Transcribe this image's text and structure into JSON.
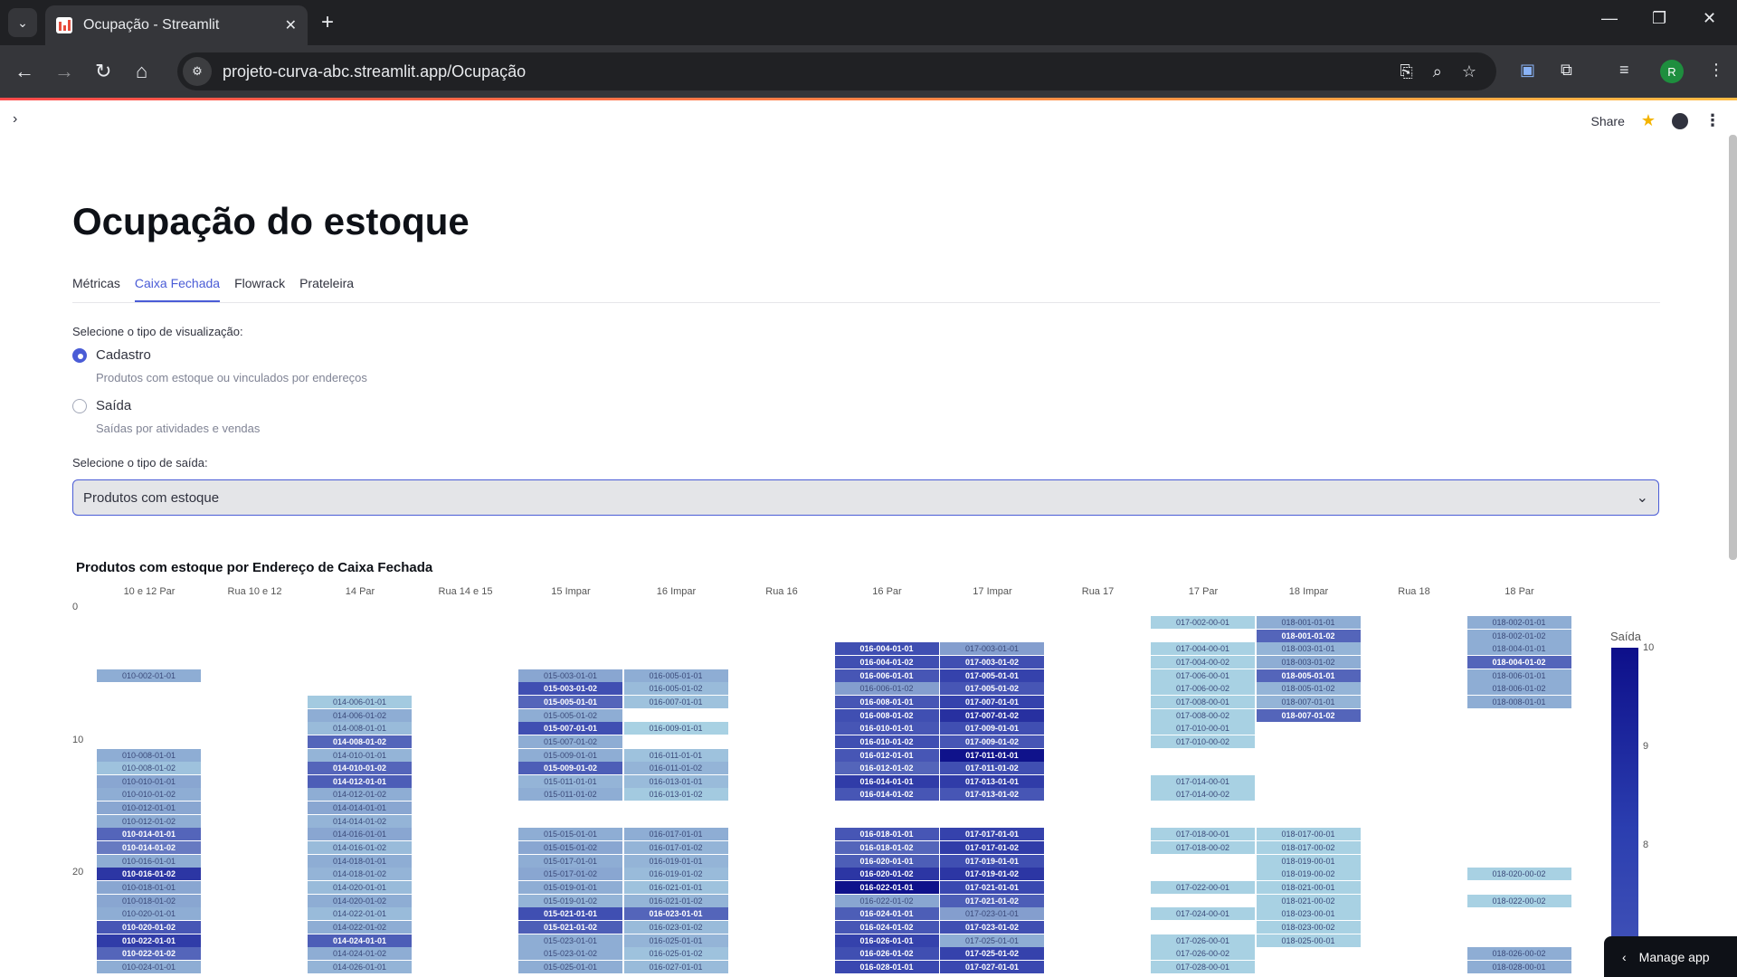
{
  "browser": {
    "tab_title": "Ocupação - Streamlit",
    "url": "projeto-curva-abc.streamlit.app/Ocupação",
    "profile_initial": "R"
  },
  "header": {
    "share_label": "Share"
  },
  "page": {
    "title": "Ocupação do estoque",
    "tabs": [
      "Métricas",
      "Caixa Fechada",
      "Flowrack",
      "Prateleira"
    ],
    "active_tab": "Caixa Fechada",
    "viz_label": "Selecione o tipo de visualização:",
    "viz_options": [
      {
        "label": "Cadastro",
        "caption": "Produtos com estoque ou vinculados por endereços",
        "selected": true
      },
      {
        "label": "Saída",
        "caption": "Saídas por atividades e vendas",
        "selected": false
      }
    ],
    "saida_label": "Selecione o tipo de saída:",
    "saida_value": "Produtos com estoque"
  },
  "chart_data": {
    "type": "heatmap",
    "title": "Produtos com estoque por Endereço de Caixa Fechada",
    "columns": [
      "10 e 12 Par",
      "Rua 10 e 12",
      "14 Par",
      "Rua 14 e 15",
      "15 Impar",
      "16 Impar",
      "Rua 16",
      "16 Par",
      "17 Impar",
      "Rua 17",
      "17 Par",
      "18 Impar",
      "Rua 18",
      "18 Par"
    ],
    "y_ticks": [
      0,
      10,
      20
    ],
    "legend_title": "Saída",
    "legend_ticks": [
      10,
      9,
      8
    ],
    "cells": [
      {
        "col": 0,
        "row": 4,
        "label": "010-002-01-01",
        "v": 7.6
      },
      {
        "col": 0,
        "row": 10,
        "label": "010-008-01-01",
        "v": 7.6
      },
      {
        "col": 0,
        "row": 11,
        "label": "010-008-01-02",
        "v": 7.3
      },
      {
        "col": 0,
        "row": 12,
        "label": "010-010-01-01",
        "v": 7.7
      },
      {
        "col": 0,
        "row": 13,
        "label": "010-010-01-02",
        "v": 7.6
      },
      {
        "col": 0,
        "row": 14,
        "label": "010-012-01-01",
        "v": 7.7
      },
      {
        "col": 0,
        "row": 15,
        "label": "010-012-01-02",
        "v": 7.6
      },
      {
        "col": 0,
        "row": 16,
        "label": "010-014-01-01",
        "v": 8.6
      },
      {
        "col": 0,
        "row": 17,
        "label": "010-014-01-02",
        "v": 8.3
      },
      {
        "col": 0,
        "row": 18,
        "label": "010-016-01-01",
        "v": 7.6
      },
      {
        "col": 0,
        "row": 19,
        "label": "010-016-01-02",
        "v": 9.3
      },
      {
        "col": 0,
        "row": 20,
        "label": "010-018-01-01",
        "v": 7.7
      },
      {
        "col": 0,
        "row": 21,
        "label": "010-018-01-02",
        "v": 7.7
      },
      {
        "col": 0,
        "row": 22,
        "label": "010-020-01-01",
        "v": 7.6
      },
      {
        "col": 0,
        "row": 23,
        "label": "010-020-01-02",
        "v": 8.8
      },
      {
        "col": 0,
        "row": 24,
        "label": "010-022-01-01",
        "v": 9.2
      },
      {
        "col": 0,
        "row": 25,
        "label": "010-022-01-02",
        "v": 8.6
      },
      {
        "col": 0,
        "row": 26,
        "label": "010-024-01-01",
        "v": 7.6
      },
      {
        "col": 2,
        "row": 6,
        "label": "014-006-01-01",
        "v": 7.2
      },
      {
        "col": 2,
        "row": 7,
        "label": "014-006-01-02",
        "v": 7.6
      },
      {
        "col": 2,
        "row": 8,
        "label": "014-008-01-01",
        "v": 7.4
      },
      {
        "col": 2,
        "row": 9,
        "label": "014-008-01-02",
        "v": 8.6
      },
      {
        "col": 2,
        "row": 10,
        "label": "014-010-01-01",
        "v": 7.5
      },
      {
        "col": 2,
        "row": 11,
        "label": "014-010-01-02",
        "v": 8.6
      },
      {
        "col": 2,
        "row": 12,
        "label": "014-012-01-01",
        "v": 8.7
      },
      {
        "col": 2,
        "row": 13,
        "label": "014-012-01-02",
        "v": 7.6
      },
      {
        "col": 2,
        "row": 14,
        "label": "014-014-01-01",
        "v": 7.7
      },
      {
        "col": 2,
        "row": 15,
        "label": "014-014-01-02",
        "v": 7.5
      },
      {
        "col": 2,
        "row": 16,
        "label": "014-016-01-01",
        "v": 7.7
      },
      {
        "col": 2,
        "row": 17,
        "label": "014-016-01-02",
        "v": 7.4
      },
      {
        "col": 2,
        "row": 18,
        "label": "014-018-01-01",
        "v": 7.6
      },
      {
        "col": 2,
        "row": 19,
        "label": "014-018-01-02",
        "v": 7.5
      },
      {
        "col": 2,
        "row": 20,
        "label": "014-020-01-01",
        "v": 7.4
      },
      {
        "col": 2,
        "row": 21,
        "label": "014-020-01-02",
        "v": 7.6
      },
      {
        "col": 2,
        "row": 22,
        "label": "014-022-01-01",
        "v": 7.4
      },
      {
        "col": 2,
        "row": 23,
        "label": "014-022-01-02",
        "v": 7.6
      },
      {
        "col": 2,
        "row": 24,
        "label": "014-024-01-01",
        "v": 8.7
      },
      {
        "col": 2,
        "row": 25,
        "label": "014-024-01-02",
        "v": 7.6
      },
      {
        "col": 2,
        "row": 26,
        "label": "014-026-01-01",
        "v": 7.5
      },
      {
        "col": 4,
        "row": 4,
        "label": "015-003-01-01",
        "v": 7.7
      },
      {
        "col": 4,
        "row": 5,
        "label": "015-003-01-02",
        "v": 8.9
      },
      {
        "col": 4,
        "row": 6,
        "label": "015-005-01-01",
        "v": 8.6
      },
      {
        "col": 4,
        "row": 7,
        "label": "015-005-01-02",
        "v": 7.6
      },
      {
        "col": 4,
        "row": 8,
        "label": "015-007-01-01",
        "v": 8.9
      },
      {
        "col": 4,
        "row": 9,
        "label": "015-007-01-02",
        "v": 7.6
      },
      {
        "col": 4,
        "row": 10,
        "label": "015-009-01-01",
        "v": 7.6
      },
      {
        "col": 4,
        "row": 11,
        "label": "015-009-01-02",
        "v": 8.7
      },
      {
        "col": 4,
        "row": 12,
        "label": "015-011-01-01",
        "v": 7.5
      },
      {
        "col": 4,
        "row": 13,
        "label": "015-011-01-02",
        "v": 7.6
      },
      {
        "col": 4,
        "row": 16,
        "label": "015-015-01-01",
        "v": 7.6
      },
      {
        "col": 4,
        "row": 17,
        "label": "015-015-01-02",
        "v": 7.7
      },
      {
        "col": 4,
        "row": 18,
        "label": "015-017-01-01",
        "v": 7.6
      },
      {
        "col": 4,
        "row": 19,
        "label": "015-017-01-02",
        "v": 7.7
      },
      {
        "col": 4,
        "row": 20,
        "label": "015-019-01-01",
        "v": 7.6
      },
      {
        "col": 4,
        "row": 21,
        "label": "015-019-01-02",
        "v": 7.5
      },
      {
        "col": 4,
        "row": 22,
        "label": "015-021-01-01",
        "v": 8.9
      },
      {
        "col": 4,
        "row": 23,
        "label": "015-021-01-02",
        "v": 8.7
      },
      {
        "col": 4,
        "row": 24,
        "label": "015-023-01-01",
        "v": 7.6
      },
      {
        "col": 4,
        "row": 25,
        "label": "015-023-01-02",
        "v": 7.6
      },
      {
        "col": 4,
        "row": 26,
        "label": "015-025-01-01",
        "v": 7.6
      },
      {
        "col": 5,
        "row": 4,
        "label": "016-005-01-01",
        "v": 7.6
      },
      {
        "col": 5,
        "row": 5,
        "label": "016-005-01-02",
        "v": 7.4
      },
      {
        "col": 5,
        "row": 6,
        "label": "016-007-01-01",
        "v": 7.3
      },
      {
        "col": 5,
        "row": 8,
        "label": "016-009-01-01",
        "v": 7.1
      },
      {
        "col": 5,
        "row": 10,
        "label": "016-011-01-01",
        "v": 7.3
      },
      {
        "col": 5,
        "row": 11,
        "label": "016-011-01-02",
        "v": 7.5
      },
      {
        "col": 5,
        "row": 12,
        "label": "016-013-01-01",
        "v": 7.4
      },
      {
        "col": 5,
        "row": 13,
        "label": "016-013-01-02",
        "v": 7.2
      },
      {
        "col": 5,
        "row": 16,
        "label": "016-017-01-01",
        "v": 7.6
      },
      {
        "col": 5,
        "row": 17,
        "label": "016-017-01-02",
        "v": 7.5
      },
      {
        "col": 5,
        "row": 18,
        "label": "016-019-01-01",
        "v": 7.5
      },
      {
        "col": 5,
        "row": 19,
        "label": "016-019-01-02",
        "v": 7.4
      },
      {
        "col": 5,
        "row": 20,
        "label": "016-021-01-01",
        "v": 7.3
      },
      {
        "col": 5,
        "row": 21,
        "label": "016-021-01-02",
        "v": 7.5
      },
      {
        "col": 5,
        "row": 22,
        "label": "016-023-01-01",
        "v": 8.6
      },
      {
        "col": 5,
        "row": 23,
        "label": "016-023-01-02",
        "v": 7.4
      },
      {
        "col": 5,
        "row": 24,
        "label": "016-025-01-01",
        "v": 7.5
      },
      {
        "col": 5,
        "row": 25,
        "label": "016-025-01-02",
        "v": 7.3
      },
      {
        "col": 5,
        "row": 26,
        "label": "016-027-01-01",
        "v": 7.4
      },
      {
        "col": 7,
        "row": 2,
        "label": "016-004-01-01",
        "v": 8.9
      },
      {
        "col": 7,
        "row": 3,
        "label": "016-004-01-02",
        "v": 8.9
      },
      {
        "col": 7,
        "row": 4,
        "label": "016-006-01-01",
        "v": 8.8
      },
      {
        "col": 7,
        "row": 5,
        "label": "016-006-01-02",
        "v": 7.8
      },
      {
        "col": 7,
        "row": 6,
        "label": "016-008-01-01",
        "v": 8.8
      },
      {
        "col": 7,
        "row": 7,
        "label": "016-008-01-02",
        "v": 8.9
      },
      {
        "col": 7,
        "row": 8,
        "label": "016-010-01-01",
        "v": 8.8
      },
      {
        "col": 7,
        "row": 9,
        "label": "016-010-01-02",
        "v": 8.9
      },
      {
        "col": 7,
        "row": 10,
        "label": "016-012-01-01",
        "v": 8.8
      },
      {
        "col": 7,
        "row": 11,
        "label": "016-012-01-02",
        "v": 8.6
      },
      {
        "col": 7,
        "row": 12,
        "label": "016-014-01-01",
        "v": 9.2
      },
      {
        "col": 7,
        "row": 13,
        "label": "016-014-01-02",
        "v": 8.8
      },
      {
        "col": 7,
        "row": 16,
        "label": "016-018-01-01",
        "v": 8.8
      },
      {
        "col": 7,
        "row": 17,
        "label": "016-018-01-02",
        "v": 8.6
      },
      {
        "col": 7,
        "row": 18,
        "label": "016-020-01-01",
        "v": 8.7
      },
      {
        "col": 7,
        "row": 19,
        "label": "016-020-01-02",
        "v": 9.3
      },
      {
        "col": 7,
        "row": 20,
        "label": "016-022-01-01",
        "v": 9.9
      },
      {
        "col": 7,
        "row": 21,
        "label": "016-022-01-02",
        "v": 7.7
      },
      {
        "col": 7,
        "row": 22,
        "label": "016-024-01-01",
        "v": 8.7
      },
      {
        "col": 7,
        "row": 23,
        "label": "016-024-01-02",
        "v": 8.8
      },
      {
        "col": 7,
        "row": 24,
        "label": "016-026-01-01",
        "v": 9.1
      },
      {
        "col": 7,
        "row": 25,
        "label": "016-026-01-02",
        "v": 8.9
      },
      {
        "col": 7,
        "row": 26,
        "label": "016-028-01-01",
        "v": 9.0
      },
      {
        "col": 8,
        "row": 2,
        "label": "017-003-01-01",
        "v": 7.8
      },
      {
        "col": 8,
        "row": 3,
        "label": "017-003-01-02",
        "v": 8.9
      },
      {
        "col": 8,
        "row": 4,
        "label": "017-005-01-01",
        "v": 9.1
      },
      {
        "col": 8,
        "row": 5,
        "label": "017-005-01-02",
        "v": 8.8
      },
      {
        "col": 8,
        "row": 6,
        "label": "017-007-01-01",
        "v": 9.1
      },
      {
        "col": 8,
        "row": 7,
        "label": "017-007-01-02",
        "v": 9.4
      },
      {
        "col": 8,
        "row": 8,
        "label": "017-009-01-01",
        "v": 8.9
      },
      {
        "col": 8,
        "row": 9,
        "label": "017-009-01-02",
        "v": 8.8
      },
      {
        "col": 8,
        "row": 10,
        "label": "017-011-01-01",
        "v": 9.9
      },
      {
        "col": 8,
        "row": 11,
        "label": "017-011-01-02",
        "v": 8.9
      },
      {
        "col": 8,
        "row": 12,
        "label": "017-013-01-01",
        "v": 9.2
      },
      {
        "col": 8,
        "row": 13,
        "label": "017-013-01-02",
        "v": 8.8
      },
      {
        "col": 8,
        "row": 16,
        "label": "017-017-01-01",
        "v": 9.1
      },
      {
        "col": 8,
        "row": 17,
        "label": "017-017-01-02",
        "v": 9.2
      },
      {
        "col": 8,
        "row": 18,
        "label": "017-019-01-01",
        "v": 8.9
      },
      {
        "col": 8,
        "row": 19,
        "label": "017-019-01-02",
        "v": 9.3
      },
      {
        "col": 8,
        "row": 20,
        "label": "017-021-01-01",
        "v": 9.0
      },
      {
        "col": 8,
        "row": 21,
        "label": "017-021-01-02",
        "v": 8.7
      },
      {
        "col": 8,
        "row": 22,
        "label": "017-023-01-01",
        "v": 7.8
      },
      {
        "col": 8,
        "row": 23,
        "label": "017-023-01-02",
        "v": 8.9
      },
      {
        "col": 8,
        "row": 24,
        "label": "017-025-01-01",
        "v": 7.6
      },
      {
        "col": 8,
        "row": 25,
        "label": "017-025-01-02",
        "v": 9.1
      },
      {
        "col": 8,
        "row": 26,
        "label": "017-027-01-01",
        "v": 9.0
      },
      {
        "col": 10,
        "row": 0,
        "label": "017-002-00-01",
        "v": 7.1
      },
      {
        "col": 10,
        "row": 2,
        "label": "017-004-00-01",
        "v": 7.1
      },
      {
        "col": 10,
        "row": 3,
        "label": "017-004-00-02",
        "v": 7.1
      },
      {
        "col": 10,
        "row": 4,
        "label": "017-006-00-01",
        "v": 7.1
      },
      {
        "col": 10,
        "row": 5,
        "label": "017-006-00-02",
        "v": 7.1
      },
      {
        "col": 10,
        "row": 6,
        "label": "017-008-00-01",
        "v": 7.1
      },
      {
        "col": 10,
        "row": 7,
        "label": "017-008-00-02",
        "v": 7.1
      },
      {
        "col": 10,
        "row": 8,
        "label": "017-010-00-01",
        "v": 7.1
      },
      {
        "col": 10,
        "row": 9,
        "label": "017-010-00-02",
        "v": 7.1
      },
      {
        "col": 10,
        "row": 12,
        "label": "017-014-00-01",
        "v": 7.1
      },
      {
        "col": 10,
        "row": 13,
        "label": "017-014-00-02",
        "v": 7.1
      },
      {
        "col": 10,
        "row": 16,
        "label": "017-018-00-01",
        "v": 7.1
      },
      {
        "col": 10,
        "row": 17,
        "label": "017-018-00-02",
        "v": 7.1
      },
      {
        "col": 10,
        "row": 20,
        "label": "017-022-00-01",
        "v": 7.1
      },
      {
        "col": 10,
        "row": 22,
        "label": "017-024-00-01",
        "v": 7.1
      },
      {
        "col": 10,
        "row": 24,
        "label": "017-026-00-01",
        "v": 7.1
      },
      {
        "col": 10,
        "row": 25,
        "label": "017-026-00-02",
        "v": 7.1
      },
      {
        "col": 10,
        "row": 26,
        "label": "017-028-00-01",
        "v": 7.1
      },
      {
        "col": 11,
        "row": 0,
        "label": "018-001-01-01",
        "v": 7.6
      },
      {
        "col": 11,
        "row": 1,
        "label": "018-001-01-02",
        "v": 8.6
      },
      {
        "col": 11,
        "row": 2,
        "label": "018-003-01-01",
        "v": 7.5
      },
      {
        "col": 11,
        "row": 3,
        "label": "018-003-01-02",
        "v": 7.6
      },
      {
        "col": 11,
        "row": 4,
        "label": "018-005-01-01",
        "v": 8.6
      },
      {
        "col": 11,
        "row": 5,
        "label": "018-005-01-02",
        "v": 7.5
      },
      {
        "col": 11,
        "row": 6,
        "label": "018-007-01-01",
        "v": 7.5
      },
      {
        "col": 11,
        "row": 7,
        "label": "018-007-01-02",
        "v": 8.6
      },
      {
        "col": 11,
        "row": 16,
        "label": "018-017-00-01",
        "v": 7.1
      },
      {
        "col": 11,
        "row": 17,
        "label": "018-017-00-02",
        "v": 7.1
      },
      {
        "col": 11,
        "row": 18,
        "label": "018-019-00-01",
        "v": 7.1
      },
      {
        "col": 11,
        "row": 19,
        "label": "018-019-00-02",
        "v": 7.1
      },
      {
        "col": 11,
        "row": 20,
        "label": "018-021-00-01",
        "v": 7.1
      },
      {
        "col": 11,
        "row": 21,
        "label": "018-021-00-02",
        "v": 7.1
      },
      {
        "col": 11,
        "row": 22,
        "label": "018-023-00-01",
        "v": 7.1
      },
      {
        "col": 11,
        "row": 23,
        "label": "018-023-00-02",
        "v": 7.1
      },
      {
        "col": 11,
        "row": 24,
        "label": "018-025-00-01",
        "v": 7.1
      },
      {
        "col": 13,
        "row": 0,
        "label": "018-002-01-01",
        "v": 7.6
      },
      {
        "col": 13,
        "row": 1,
        "label": "018-002-01-02",
        "v": 7.6
      },
      {
        "col": 13,
        "row": 2,
        "label": "018-004-01-01",
        "v": 7.6
      },
      {
        "col": 13,
        "row": 3,
        "label": "018-004-01-02",
        "v": 8.6
      },
      {
        "col": 13,
        "row": 4,
        "label": "018-006-01-01",
        "v": 7.6
      },
      {
        "col": 13,
        "row": 5,
        "label": "018-006-01-02",
        "v": 7.6
      },
      {
        "col": 13,
        "row": 6,
        "label": "018-008-01-01",
        "v": 7.6
      },
      {
        "col": 13,
        "row": 19,
        "label": "018-020-00-02",
        "v": 7.1
      },
      {
        "col": 13,
        "row": 21,
        "label": "018-022-00-02",
        "v": 7.1
      },
      {
        "col": 13,
        "row": 25,
        "label": "018-026-00-02",
        "v": 7.6
      },
      {
        "col": 13,
        "row": 26,
        "label": "018-028-00-01",
        "v": 7.6
      }
    ]
  },
  "manage_app_label": "Manage app"
}
